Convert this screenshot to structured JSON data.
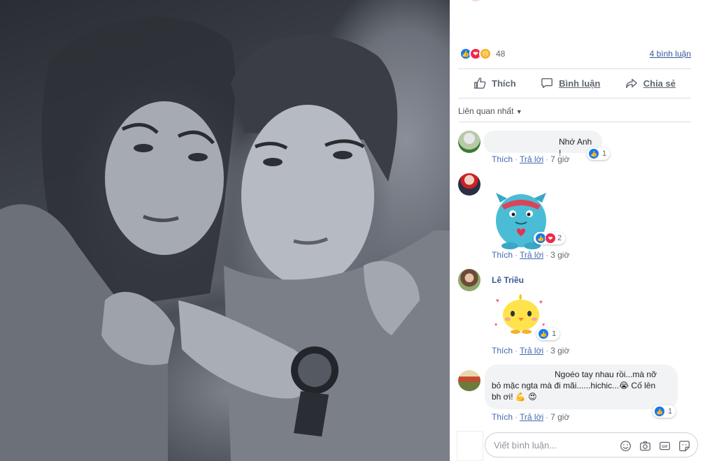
{
  "post": {
    "reaction_count": "48",
    "comments_link": "4 bình luận"
  },
  "actions": {
    "like": "Thích",
    "comment": "Bình luận",
    "share": "Chia sẻ"
  },
  "sort_label": "Liên quan nhất",
  "comments": [
    {
      "text": "Nhớ Anh !",
      "like_label": "Thích",
      "reply_label": "Trả lời",
      "time": "7 giờ",
      "reaction_count": "1"
    },
    {
      "like_label": "Thích",
      "reply_label": "Trả lời",
      "time": "3 giờ",
      "reaction_count": "2"
    },
    {
      "name": "Lê Triều",
      "like_label": "Thích",
      "reply_label": "Trả lời",
      "time": "3 giờ",
      "reaction_count": "1"
    },
    {
      "text_line1": "Ngoéo tay nhau rồi...mà nỡ",
      "text_line2": "bỏ mặc ngta mà đi mãi......hichic...😭 Cố lên",
      "text_line3": "bh ơi! 💪 😍",
      "like_label": "Thích",
      "reply_label": "Trả lời",
      "time": "7 giờ",
      "reaction_count": "1"
    }
  ],
  "composer": {
    "placeholder": "Viết bình luận...",
    "gif_label": "GIF"
  },
  "colors": {
    "link_blue": "#385898",
    "like_blue": "#1877f2",
    "love_red": "#f0284a",
    "bubble_gray": "#f2f3f5"
  },
  "icons": [
    "like-icon",
    "love-icon",
    "sad-icon",
    "thumb-icon",
    "comment-icon",
    "share-icon",
    "emoji-icon",
    "camera-icon",
    "gif-icon",
    "sticker-icon"
  ]
}
